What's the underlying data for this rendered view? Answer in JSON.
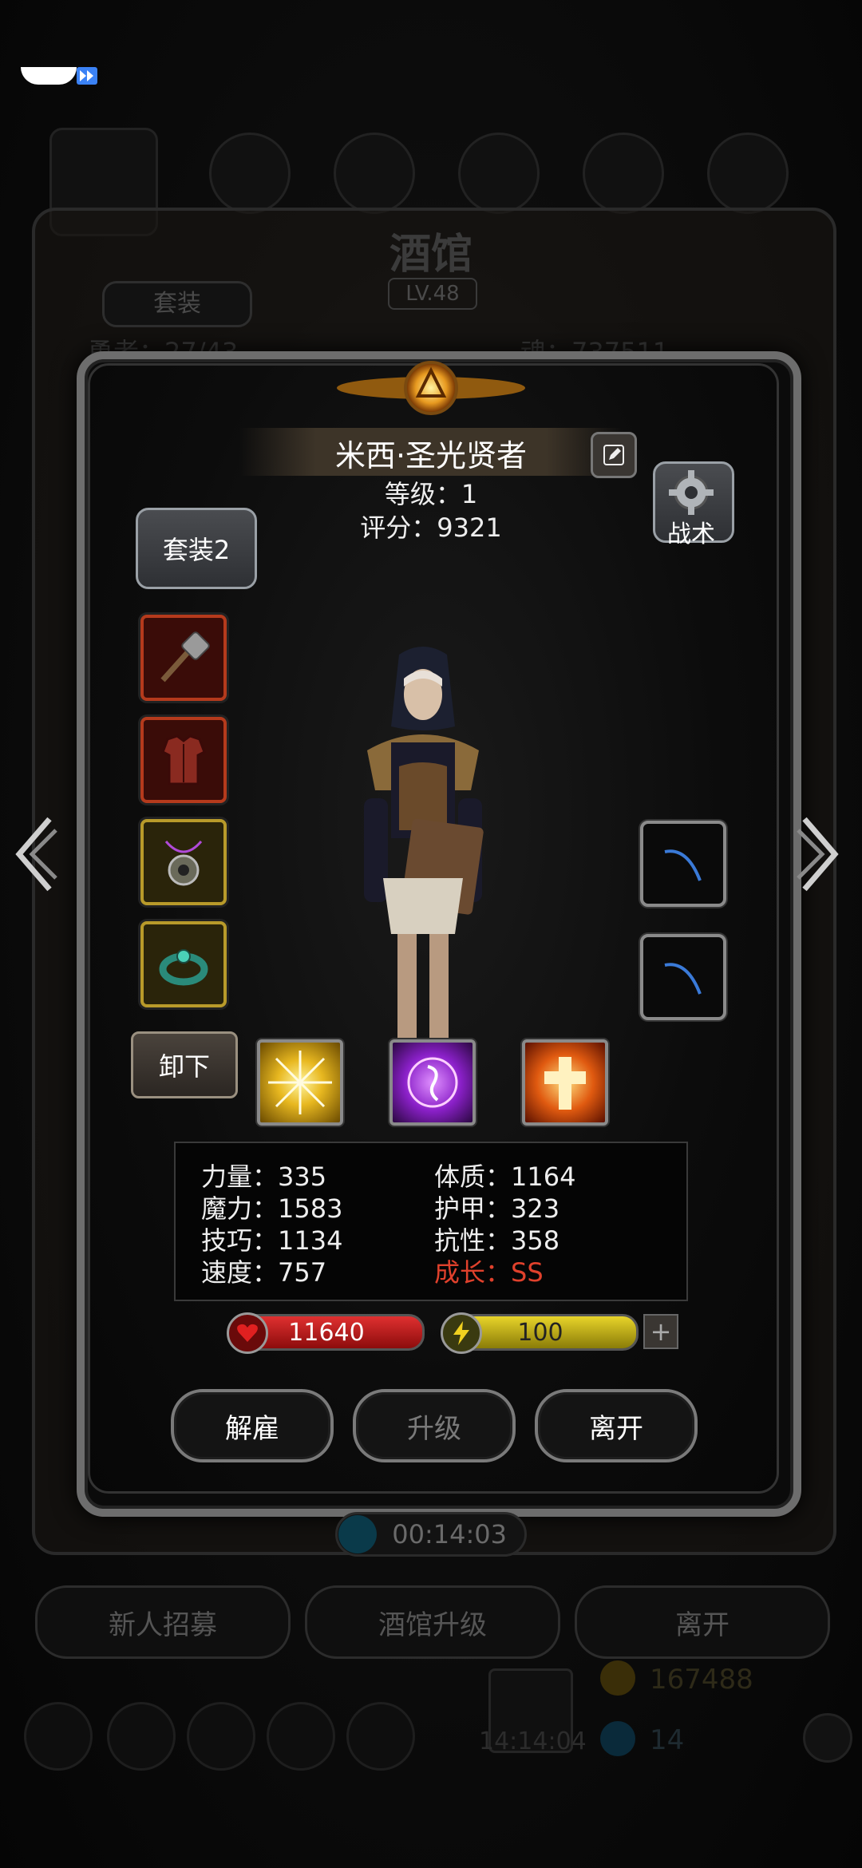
{
  "background": {
    "title": "酒馆",
    "level": "LV.48",
    "set_tab": "套装",
    "left_counter": "勇者：27/43",
    "right_counter": "魂：737511",
    "timer": "00:14:03",
    "buttons": [
      "新人招募",
      "酒馆升级",
      "离开"
    ],
    "currency_gold": "167488",
    "currency_gem": "14",
    "gift_timer": "14:14:04"
  },
  "hero": {
    "name": "米西·圣光贤者",
    "level_label": "等级：1",
    "score_label": "评分：9321"
  },
  "buttons": {
    "set": "套装2",
    "tactics": "战术",
    "unequip": "卸下",
    "dismiss": "解雇",
    "upgrade": "升级",
    "leave": "离开"
  },
  "equipment": [
    {
      "slot": "weapon",
      "icon": "mace-icon",
      "rarity": "red"
    },
    {
      "slot": "armor",
      "icon": "armor-icon",
      "rarity": "red"
    },
    {
      "slot": "amulet",
      "icon": "amulet-icon",
      "rarity": "gold"
    },
    {
      "slot": "ring",
      "icon": "ring-icon",
      "rarity": "gold"
    }
  ],
  "side_slots": [
    {
      "icon": "empty-slot-icon"
    },
    {
      "icon": "empty-slot-icon"
    }
  ],
  "skills": [
    {
      "icon": "light-burst-icon"
    },
    {
      "icon": "arcane-rune-icon"
    },
    {
      "icon": "holy-cross-icon"
    }
  ],
  "stats": {
    "strength": "力量：335",
    "constitution": "体质：1164",
    "magic": "魔力：1583",
    "armor": "护甲：323",
    "skill": "技巧：1134",
    "resistance": "抗性：358",
    "speed": "速度：757",
    "growth": "成长：SS"
  },
  "hp": "11640",
  "energy": "100",
  "plus": "+",
  "colors": {
    "hp_red": "#d42020",
    "energy_yellow": "#e0cc20",
    "growth_red": "#e0412c",
    "frame_grey": "#6d6d6d"
  }
}
